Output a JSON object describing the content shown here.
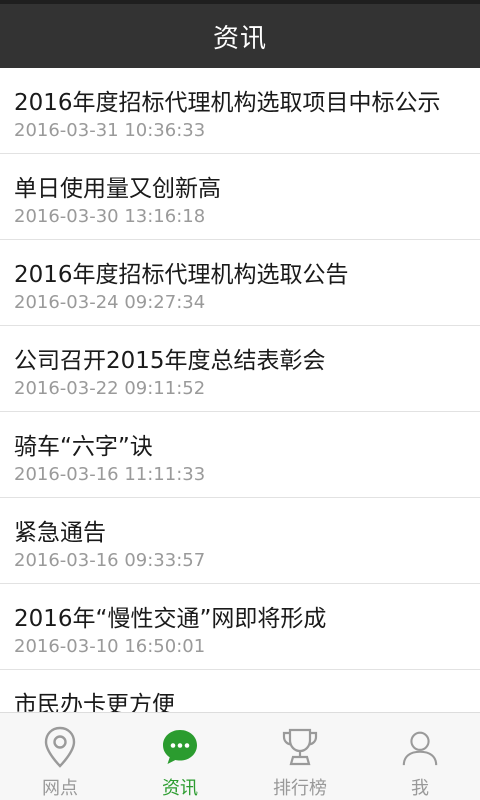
{
  "header": {
    "title": "资讯"
  },
  "news": [
    {
      "title": "2016年度招标代理机构选取项目中标公示",
      "date": "2016-03-31 10:36:33"
    },
    {
      "title": "单日使用量又创新高",
      "date": "2016-03-30 13:16:18"
    },
    {
      "title": "2016年度招标代理机构选取公告",
      "date": "2016-03-24 09:27:34"
    },
    {
      "title": "公司召开2015年度总结表彰会",
      "date": "2016-03-22 09:11:52"
    },
    {
      "title": "骑车“六字”诀",
      "date": "2016-03-16 11:11:33"
    },
    {
      "title": "紧急通告",
      "date": "2016-03-16 09:33:57"
    },
    {
      "title": "2016年“慢性交通”网即将形成",
      "date": "2016-03-10 16:50:01"
    },
    {
      "title": "市民办卡更方便",
      "date": ""
    }
  ],
  "tabs": [
    {
      "label": "网点",
      "icon": "location-pin-icon"
    },
    {
      "label": "资讯",
      "icon": "chat-bubble-icon"
    },
    {
      "label": "排行榜",
      "icon": "trophy-icon"
    },
    {
      "label": "我",
      "icon": "user-icon"
    }
  ],
  "colors": {
    "header_bg": "#333333",
    "accent": "#2b9c2f",
    "inactive": "#999999"
  }
}
